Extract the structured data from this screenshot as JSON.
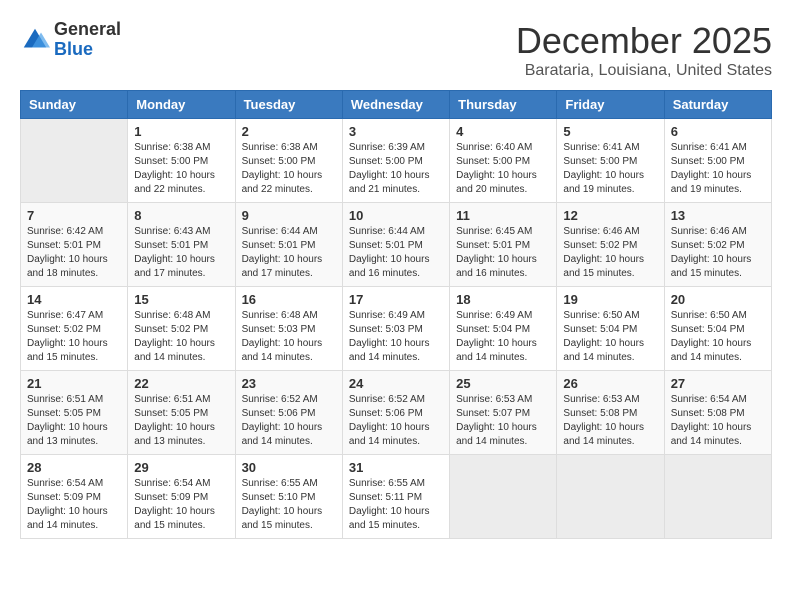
{
  "header": {
    "logo_general": "General",
    "logo_blue": "Blue",
    "month_title": "December 2025",
    "location": "Barataria, Louisiana, United States"
  },
  "calendar": {
    "days_of_week": [
      "Sunday",
      "Monday",
      "Tuesday",
      "Wednesday",
      "Thursday",
      "Friday",
      "Saturday"
    ],
    "weeks": [
      [
        {
          "day": "",
          "info": ""
        },
        {
          "day": "1",
          "info": "Sunrise: 6:38 AM\nSunset: 5:00 PM\nDaylight: 10 hours\nand 22 minutes."
        },
        {
          "day": "2",
          "info": "Sunrise: 6:38 AM\nSunset: 5:00 PM\nDaylight: 10 hours\nand 22 minutes."
        },
        {
          "day": "3",
          "info": "Sunrise: 6:39 AM\nSunset: 5:00 PM\nDaylight: 10 hours\nand 21 minutes."
        },
        {
          "day": "4",
          "info": "Sunrise: 6:40 AM\nSunset: 5:00 PM\nDaylight: 10 hours\nand 20 minutes."
        },
        {
          "day": "5",
          "info": "Sunrise: 6:41 AM\nSunset: 5:00 PM\nDaylight: 10 hours\nand 19 minutes."
        },
        {
          "day": "6",
          "info": "Sunrise: 6:41 AM\nSunset: 5:00 PM\nDaylight: 10 hours\nand 19 minutes."
        }
      ],
      [
        {
          "day": "7",
          "info": "Sunrise: 6:42 AM\nSunset: 5:01 PM\nDaylight: 10 hours\nand 18 minutes."
        },
        {
          "day": "8",
          "info": "Sunrise: 6:43 AM\nSunset: 5:01 PM\nDaylight: 10 hours\nand 17 minutes."
        },
        {
          "day": "9",
          "info": "Sunrise: 6:44 AM\nSunset: 5:01 PM\nDaylight: 10 hours\nand 17 minutes."
        },
        {
          "day": "10",
          "info": "Sunrise: 6:44 AM\nSunset: 5:01 PM\nDaylight: 10 hours\nand 16 minutes."
        },
        {
          "day": "11",
          "info": "Sunrise: 6:45 AM\nSunset: 5:01 PM\nDaylight: 10 hours\nand 16 minutes."
        },
        {
          "day": "12",
          "info": "Sunrise: 6:46 AM\nSunset: 5:02 PM\nDaylight: 10 hours\nand 15 minutes."
        },
        {
          "day": "13",
          "info": "Sunrise: 6:46 AM\nSunset: 5:02 PM\nDaylight: 10 hours\nand 15 minutes."
        }
      ],
      [
        {
          "day": "14",
          "info": "Sunrise: 6:47 AM\nSunset: 5:02 PM\nDaylight: 10 hours\nand 15 minutes."
        },
        {
          "day": "15",
          "info": "Sunrise: 6:48 AM\nSunset: 5:02 PM\nDaylight: 10 hours\nand 14 minutes."
        },
        {
          "day": "16",
          "info": "Sunrise: 6:48 AM\nSunset: 5:03 PM\nDaylight: 10 hours\nand 14 minutes."
        },
        {
          "day": "17",
          "info": "Sunrise: 6:49 AM\nSunset: 5:03 PM\nDaylight: 10 hours\nand 14 minutes."
        },
        {
          "day": "18",
          "info": "Sunrise: 6:49 AM\nSunset: 5:04 PM\nDaylight: 10 hours\nand 14 minutes."
        },
        {
          "day": "19",
          "info": "Sunrise: 6:50 AM\nSunset: 5:04 PM\nDaylight: 10 hours\nand 14 minutes."
        },
        {
          "day": "20",
          "info": "Sunrise: 6:50 AM\nSunset: 5:04 PM\nDaylight: 10 hours\nand 14 minutes."
        }
      ],
      [
        {
          "day": "21",
          "info": "Sunrise: 6:51 AM\nSunset: 5:05 PM\nDaylight: 10 hours\nand 13 minutes."
        },
        {
          "day": "22",
          "info": "Sunrise: 6:51 AM\nSunset: 5:05 PM\nDaylight: 10 hours\nand 13 minutes."
        },
        {
          "day": "23",
          "info": "Sunrise: 6:52 AM\nSunset: 5:06 PM\nDaylight: 10 hours\nand 14 minutes."
        },
        {
          "day": "24",
          "info": "Sunrise: 6:52 AM\nSunset: 5:06 PM\nDaylight: 10 hours\nand 14 minutes."
        },
        {
          "day": "25",
          "info": "Sunrise: 6:53 AM\nSunset: 5:07 PM\nDaylight: 10 hours\nand 14 minutes."
        },
        {
          "day": "26",
          "info": "Sunrise: 6:53 AM\nSunset: 5:08 PM\nDaylight: 10 hours\nand 14 minutes."
        },
        {
          "day": "27",
          "info": "Sunrise: 6:54 AM\nSunset: 5:08 PM\nDaylight: 10 hours\nand 14 minutes."
        }
      ],
      [
        {
          "day": "28",
          "info": "Sunrise: 6:54 AM\nSunset: 5:09 PM\nDaylight: 10 hours\nand 14 minutes."
        },
        {
          "day": "29",
          "info": "Sunrise: 6:54 AM\nSunset: 5:09 PM\nDaylight: 10 hours\nand 15 minutes."
        },
        {
          "day": "30",
          "info": "Sunrise: 6:55 AM\nSunset: 5:10 PM\nDaylight: 10 hours\nand 15 minutes."
        },
        {
          "day": "31",
          "info": "Sunrise: 6:55 AM\nSunset: 5:11 PM\nDaylight: 10 hours\nand 15 minutes."
        },
        {
          "day": "",
          "info": ""
        },
        {
          "day": "",
          "info": ""
        },
        {
          "day": "",
          "info": ""
        }
      ]
    ]
  }
}
